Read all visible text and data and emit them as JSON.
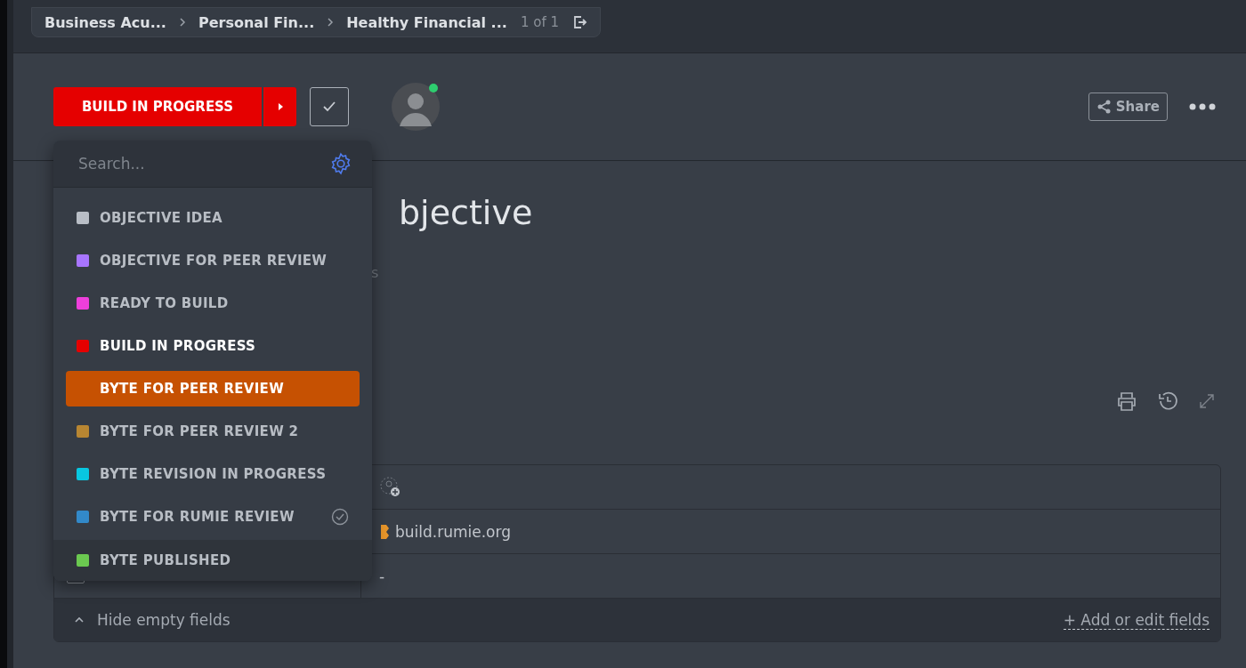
{
  "breadcrumb": {
    "items": [
      {
        "label": "Business Acu..."
      },
      {
        "label": "Personal Fin..."
      },
      {
        "label": "Healthy Financial ..."
      }
    ],
    "counter": "1 of 1"
  },
  "status_button": {
    "label": "BUILD IN PROGRESS",
    "color": "#e50000"
  },
  "assignee": {
    "online": true
  },
  "share_label": "Share",
  "title": "bjective",
  "subtitle_fragment": "s",
  "status_menu": {
    "search_placeholder": "Search...",
    "items": [
      {
        "label": "OBJECTIVE IDEA",
        "color": "#b9bec6",
        "kind": "open",
        "current": false,
        "highlighted": false,
        "checked": false
      },
      {
        "label": "OBJECTIVE FOR PEER REVIEW",
        "color": "#a875ff",
        "kind": "open",
        "current": false,
        "highlighted": false,
        "checked": false
      },
      {
        "label": "READY TO BUILD",
        "color": "#ee3fdb",
        "kind": "open",
        "current": false,
        "highlighted": false,
        "checked": false
      },
      {
        "label": "BUILD IN PROGRESS",
        "color": "#e50000",
        "kind": "open",
        "current": true,
        "highlighted": false,
        "checked": false
      },
      {
        "label": "BYTE FOR PEER REVIEW",
        "color": "#c65102",
        "kind": "open",
        "current": false,
        "highlighted": true,
        "checked": false
      },
      {
        "label": "BYTE FOR PEER REVIEW 2",
        "color": "#b88632",
        "kind": "open",
        "current": false,
        "highlighted": false,
        "checked": false
      },
      {
        "label": "BYTE REVISION IN PROGRESS",
        "color": "#08c7e0",
        "kind": "open",
        "current": false,
        "highlighted": false,
        "checked": false
      },
      {
        "label": "BYTE FOR RUMIE REVIEW",
        "color": "#3289c9",
        "kind": "open",
        "current": false,
        "highlighted": false,
        "checked": true
      },
      {
        "label": "BYTE PUBLISHED",
        "color": "#6bc950",
        "kind": "closed",
        "current": false,
        "highlighted": false,
        "checked": false
      }
    ]
  },
  "fields": {
    "rows": [
      {
        "kind": "assignee"
      },
      {
        "kind": "link",
        "value": "build.rumie.org"
      },
      {
        "kind": "checkbox",
        "value": "-"
      }
    ],
    "hide_empty": "Hide empty fields",
    "add_fields": "+ Add or edit fields"
  }
}
